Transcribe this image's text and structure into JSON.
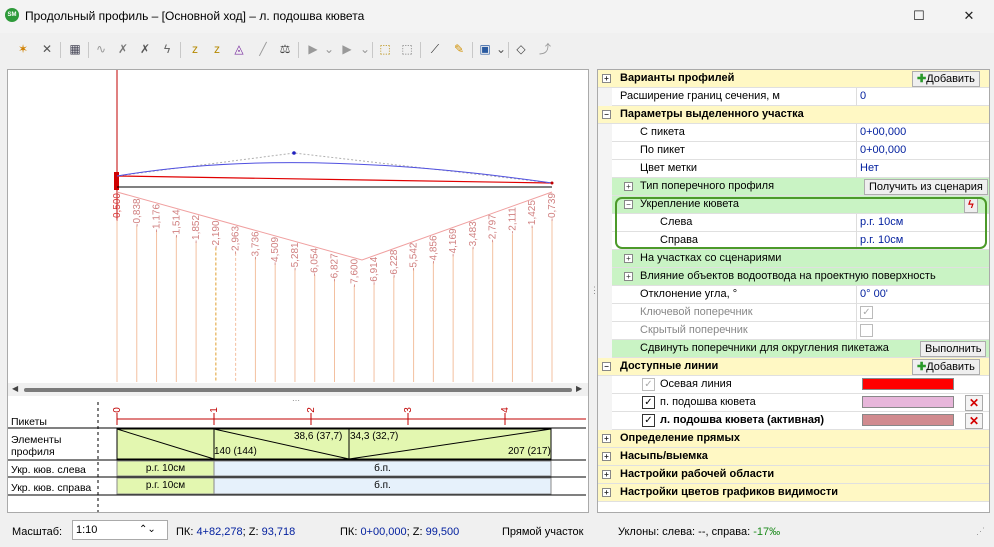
{
  "window": {
    "title": "Продольный профиль – [Основной ход] – л. подошва кювета",
    "app_icon_text": "SM"
  },
  "profile": {
    "pk_labels": [
      "-0,500",
      "-0,838",
      "-1,176",
      "-1,514",
      "-1,852",
      "-2,190",
      "-2,963",
      "-3,736",
      "-4,509",
      "-5,281",
      "-6,054",
      "-6,827",
      "-7,600",
      "-6,914",
      "-6,228",
      "-5,542",
      "-4,856",
      "-4,169",
      "-3,483",
      "-2,797",
      "-2,111",
      "-1,425",
      "-0,739"
    ]
  },
  "table": {
    "rows": {
      "pikety": "Пикеты",
      "elements": "Элементы профиля",
      "left": "Укр. кюв. слева",
      "right": "Укр. кюв. справа"
    },
    "pk_ticks": [
      "0",
      "1",
      "2",
      "3",
      "4"
    ],
    "elements": {
      "left_len": "140 (144)",
      "center_a": "38,6 (37,7)",
      "center_b": "34,3 (32,7)",
      "right_len": "207 (217)"
    },
    "left_cells": [
      "р.г. 10см",
      "б.п."
    ],
    "right_cells": [
      "р.г. 10см",
      "б.п."
    ]
  },
  "props": {
    "variants": {
      "label": "Варианты профилей",
      "add": "Добавить"
    },
    "expansion": {
      "label": "Расширение границ сечения, м",
      "value": "0"
    },
    "params": {
      "label": "Параметры выделенного участка"
    },
    "from_pk": {
      "label": "С пикета",
      "value": "0+00,000"
    },
    "to_pk": {
      "label": "По пикет",
      "value": "0+00,000"
    },
    "color": {
      "label": "Цвет метки",
      "value": "Нет"
    },
    "cross_type": {
      "label": "Тип поперечного профиля",
      "button": "Получить из сценария"
    },
    "ditch": {
      "label": "Укрепление кювета"
    },
    "ditch_left": {
      "label": "Слева",
      "value": "р.г. 10см"
    },
    "ditch_right": {
      "label": "Справа",
      "value": "р.г. 10см"
    },
    "scenarios": {
      "label": "На участках со сценариями"
    },
    "drainage": {
      "label": "Влияние объектов водоотвода на проектную поверхность"
    },
    "angle": {
      "label": "Отклонение угла, °",
      "value": "0° 00'"
    },
    "key_cross": {
      "label": "Ключевой поперечник"
    },
    "hidden_cross": {
      "label": "Скрытый поперечник"
    },
    "shift": {
      "label": "Сдвинуть поперечники для округления пикетажа",
      "button": "Выполнить"
    },
    "lines": {
      "label": "Доступные линии",
      "add": "Добавить"
    },
    "axis_line": {
      "label": "Осевая линия",
      "color": "#ff0000"
    },
    "right_ditch": {
      "label": "п. подошва кювета",
      "color": "#e7b6da"
    },
    "left_ditch": {
      "label": "л. подошва кювета (активная)",
      "color": "#d18b8f"
    },
    "straights": {
      "label": "Определение прямых"
    },
    "fill": {
      "label": "Насыпь/выемка"
    },
    "workspace": {
      "label": "Настройки рабочей области"
    },
    "colors": {
      "label": "Настройки цветов графиков видимости"
    }
  },
  "status": {
    "scale_label": "Масштаб:",
    "scale_value": "1:10",
    "pk1_label": "ПК:",
    "pk1_value": "4+82,278",
    "z1_label": "; Z:",
    "z1_value": "93,718",
    "pk2_label": "ПК:",
    "pk2_value": "0+00,000",
    "z2_label": "; Z:",
    "z2_value": "99,500",
    "segment": "Прямой участок",
    "slopes_label": "Уклоны: слева: --, справа:",
    "slopes_value": "-17‰"
  }
}
